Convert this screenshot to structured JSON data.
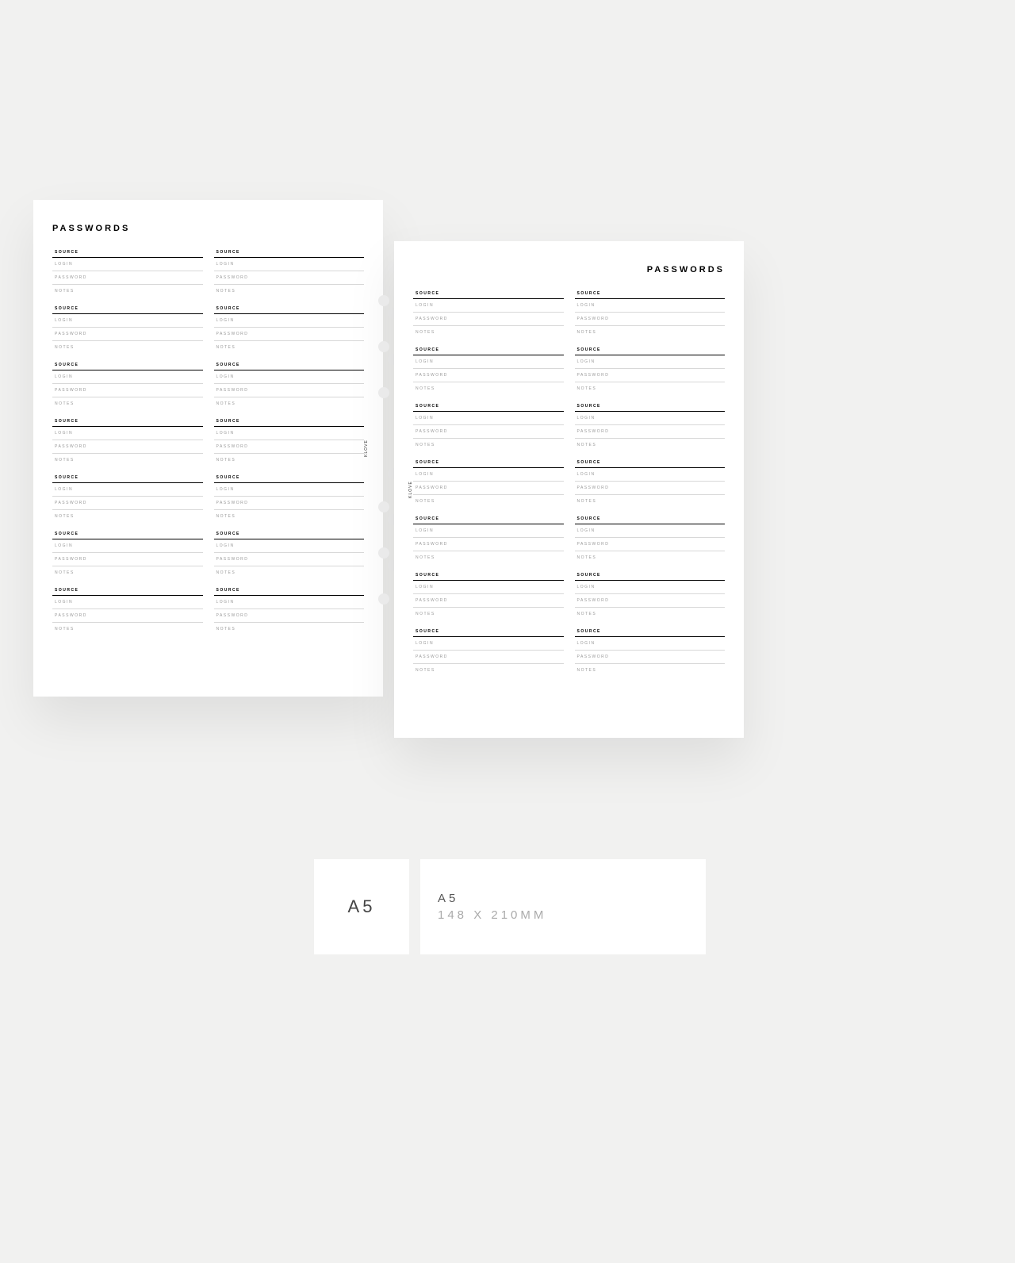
{
  "page_title": "PASSWORDS",
  "brand": "KLOVE",
  "labels": {
    "source": "SOURCE",
    "login": "LOGIN",
    "password": "PASSWORD",
    "notes": "NOTES"
  },
  "size": {
    "code": "A5",
    "name": "A5",
    "dimensions": "148 X 210MM"
  },
  "entries_per_column": 7,
  "columns_per_page": 2
}
